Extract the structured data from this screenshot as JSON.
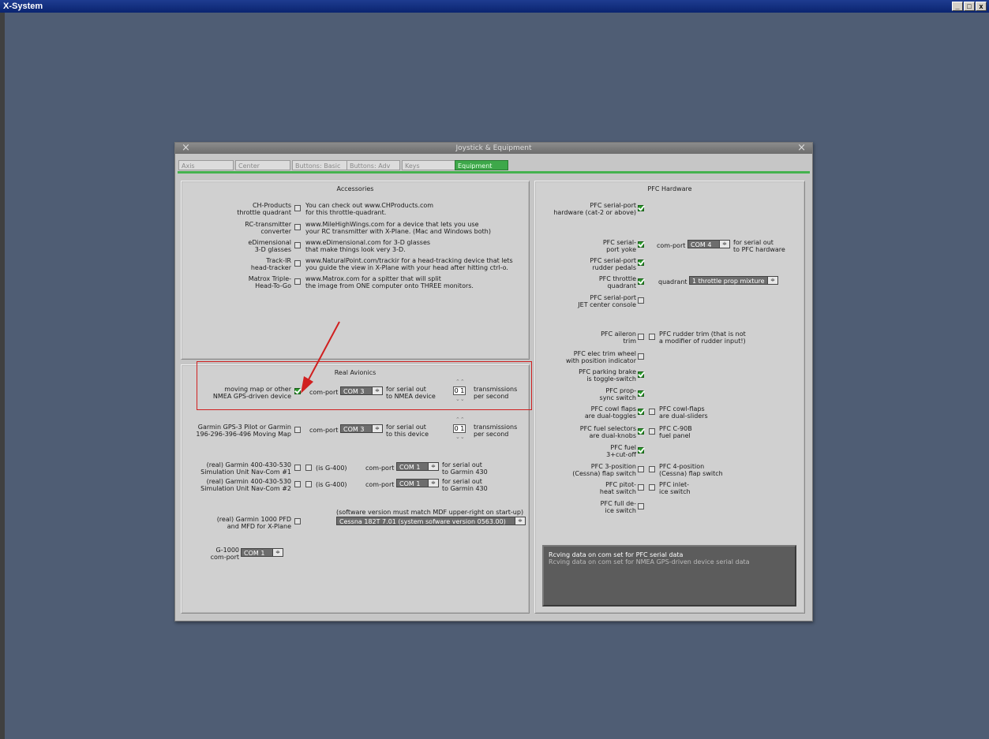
{
  "window": {
    "title": "X-System",
    "min": "_",
    "max": "□",
    "close": "x"
  },
  "dialog": {
    "title": "Joystick & Equipment",
    "close": "×"
  },
  "tabs": [
    "Axis",
    "Center",
    "Buttons: Basic",
    "Buttons: Adv",
    "Keys",
    "Equipment"
  ],
  "active_tab": "Equipment",
  "accessories": {
    "title": "Accessories",
    "items": [
      {
        "label": "CH-Products\nthrottle quadrant",
        "checked": false,
        "desc": "You can check out www.CHProducts.com\nfor this throttle-quadrant."
      },
      {
        "label": "RC-transmitter\nconverter",
        "checked": false,
        "desc": "www.MileHighWings.com for a device that lets you use\nyour RC transmitter with X-Plane. (Mac and Windows both)"
      },
      {
        "label": "eDimensional\n3-D glasses",
        "checked": false,
        "desc": "www.eDimensional.com for 3-D glasses\nthat make things look very 3-D."
      },
      {
        "label": "Track-IR\nhead-tracker",
        "checked": false,
        "desc": "www.NaturalPoint.com/trackir for a head-tracking device that lets\nyou guide the view in X-Plane with your head after hitting ctrl-o."
      },
      {
        "label": "Matrox Triple-\nHead-To-Go",
        "checked": false,
        "desc": "www.Matrox.com for a spitter that will split\nthe image from ONE computer onto THREE monitors."
      }
    ]
  },
  "avionics": {
    "title": "Real Avionics",
    "gps_label": "moving map or other\nNMEA GPS-driven device",
    "gps_checked": true,
    "comport_label": "com-port",
    "gps_port": "COM 3",
    "gps_serial": "for serial out\nto NMEA device",
    "gps_rate": "0 1",
    "rate_label": "transmissions\nper second",
    "garmin_gps_label": "Garmin GPS-3 Pilot or Garmin\n196-296-396-496 Moving Map",
    "garmin_gps_port": "COM 3",
    "garmin_gps_serial": "for serial out\nto this device",
    "garmin_gps_rate": "0 1",
    "g430_1_label": "(real) Garmin 400-430-530\nSimulation Unit Nav-Com #1",
    "g430_2_label": "(real) Garmin 400-430-530\nSimulation Unit Nav-Com #2",
    "g400_label": "(is G-400)",
    "g430_port_1": "COM 1",
    "g430_port_2": "COM 1",
    "g430_serial": "for serial out\nto Garmin 430",
    "g1000_note": "(software version must match MDF upper-right on start-up)",
    "g1000_label": "(real) Garmin 1000 PFD\nand MFD for X-Plane",
    "g1000_version": "Cessna 182T 7.01 (system sofware version 0563.00)",
    "g1000_port_label": "G-1000\ncom-port",
    "g1000_port": "COM 1"
  },
  "pfc": {
    "title": "PFC Hardware",
    "serial_hw": "PFC serial-port\nhardware (cat-2 or above)",
    "yoke": "PFC serial-\nport yoke",
    "yoke_comport": "com-port",
    "yoke_port": "COM 4",
    "yoke_serial": "for serial out\nto PFC hardware",
    "rudder": "PFC serial-port\nrudder pedals",
    "throttle": "PFC throttle\nquadrant",
    "quadrant_label": "quadrant",
    "quadrant_value": "1 throttle prop mixture",
    "jet": "PFC serial-port\nJET center console",
    "aileron": "PFC aileron\ntrim",
    "rudder_trim": "PFC rudder trim (that is not\na modifier of rudder input!)",
    "elec_trim": "PFC elec trim wheel\nwith position indicator",
    "parking": "PFC parking brake\nis toggle-switch",
    "prop_sync": "PFC prop-\nsync switch",
    "cowl_toggles": "PFC cowl flaps\nare dual-toggles",
    "cowl_sliders": "PFC cowl-flaps\nare dual-sliders",
    "fuel_sel": "PFC fuel selectors\nare dual-knobs",
    "c90b": "PFC C-90B\nfuel panel",
    "fuel_cut": "PFC fuel\n3+cut-off",
    "flap3": "PFC 3-position\n(Cessna) flap switch",
    "flap4": "PFC 4-position\n(Cessna) flap switch",
    "pitot": "PFC pitot-\nheat switch",
    "inlet": "PFC inlet-\nice switch",
    "deice": "PFC full de-\nice switch"
  },
  "status": {
    "line1": "Rcving data on com set for PFC serial data",
    "line2": "Rcving data on com set for NMEA GPS-driven device serial data"
  },
  "colors": {
    "accent_green": "#3ea84a",
    "desktop": "#4f5d74",
    "annotation_red": "#d02020"
  }
}
